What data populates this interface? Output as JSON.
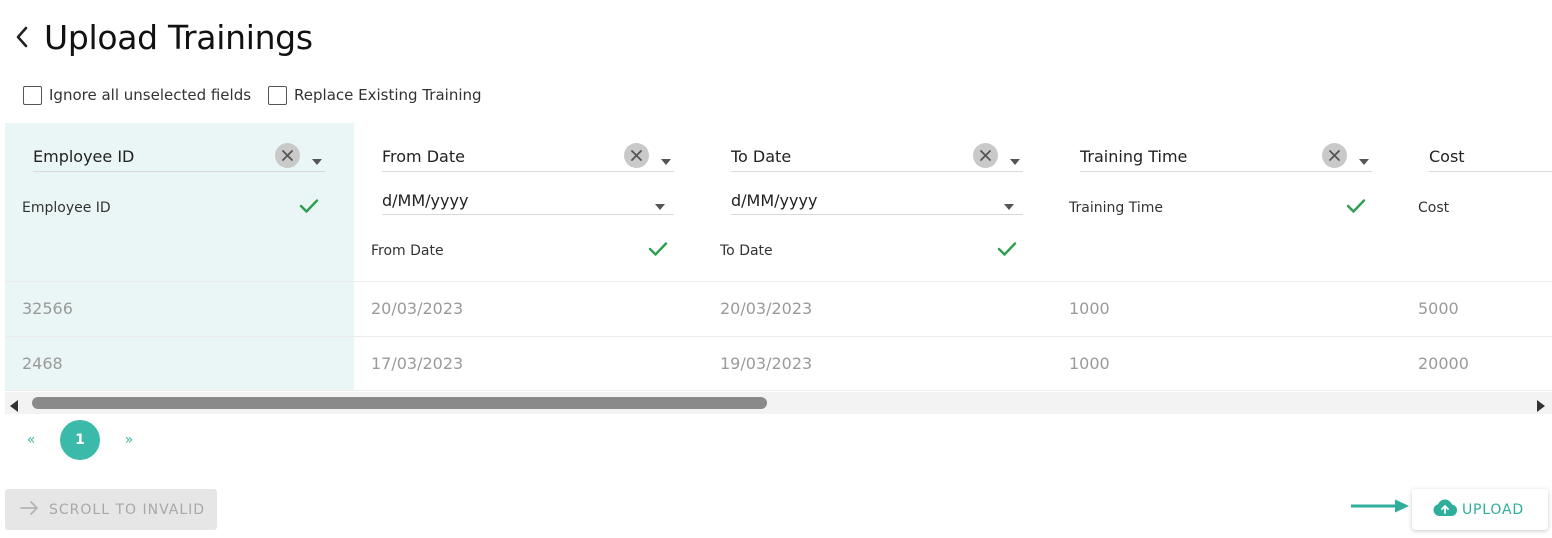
{
  "page": {
    "title": "Upload Trainings"
  },
  "options": [
    {
      "label": "Ignore all unselected fields",
      "checked": false
    },
    {
      "label": "Replace Existing Training",
      "checked": false
    }
  ],
  "columns": [
    {
      "field": "Employee ID",
      "detected": "Employee ID",
      "format": null,
      "selected": true
    },
    {
      "field": "From Date",
      "detected": "From Date",
      "format": "d/MM/yyyy",
      "selected": false
    },
    {
      "field": "To Date",
      "detected": "To Date",
      "format": "d/MM/yyyy",
      "selected": false
    },
    {
      "field": "Training Time",
      "detected": "Training Time",
      "format": null,
      "selected": false
    },
    {
      "field": "Cost",
      "detected": "Cost",
      "format": null,
      "selected": false
    }
  ],
  "rows": [
    [
      "32566",
      "20/03/2023",
      "20/03/2023",
      "1000",
      "5000"
    ],
    [
      "2468",
      "17/03/2023",
      "19/03/2023",
      "1000",
      "20000"
    ]
  ],
  "pagination": {
    "prev": "«",
    "current": "1",
    "next": "»"
  },
  "actions": {
    "scroll_invalid": "SCROLL TO INVALID",
    "upload": "UPLOAD"
  },
  "colors": {
    "accent": "#3bbaa9",
    "selected_column_bg": "#e9f6f5",
    "check": "#2e9e4f"
  },
  "icons": {
    "back": "chevron-left-icon",
    "clear": "close-icon",
    "dropdown": "caret-down-icon",
    "valid": "check-icon",
    "scroll_invalid": "arrow-right-icon",
    "upload": "cloud-upload-icon"
  }
}
